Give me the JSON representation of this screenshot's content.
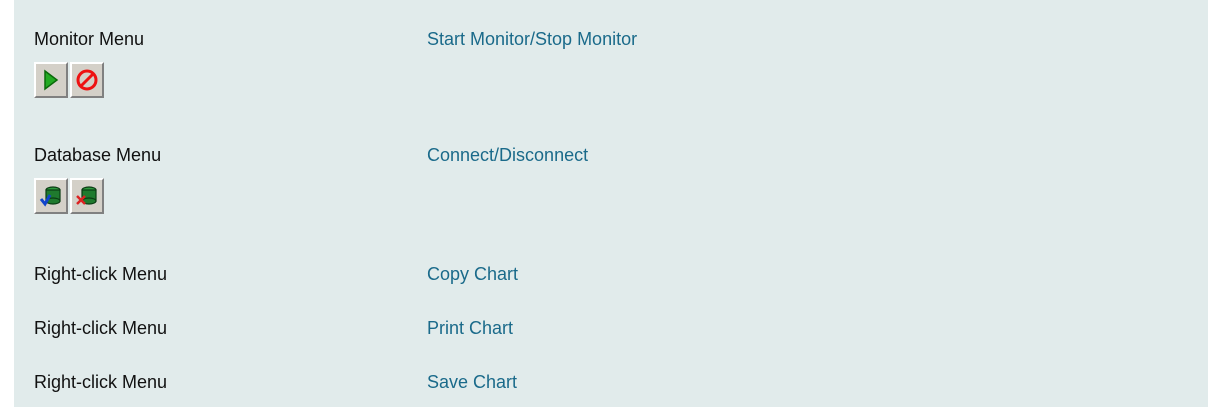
{
  "rows": [
    {
      "label": "Monitor Menu",
      "action": "Start Monitor/Stop Monitor",
      "icons": [
        "start-monitor-icon",
        "stop-monitor-icon"
      ]
    },
    {
      "label": "Database Menu",
      "action": "Connect/Disconnect",
      "icons": [
        "database-connect-icon",
        "database-disconnect-icon"
      ]
    },
    {
      "label": "Right-click Menu",
      "action": "Copy Chart"
    },
    {
      "label": "Right-click Menu",
      "action": "Print Chart"
    },
    {
      "label": "Right-click Menu",
      "action": "Save Chart"
    }
  ],
  "colors": {
    "panel_bg": "#e1ebeb",
    "link": "#1a6a8a",
    "play": "#22aa22",
    "stop": "#ee1111",
    "db": "#1f7a2e",
    "check": "#1144cc",
    "x": "#dd2222"
  }
}
